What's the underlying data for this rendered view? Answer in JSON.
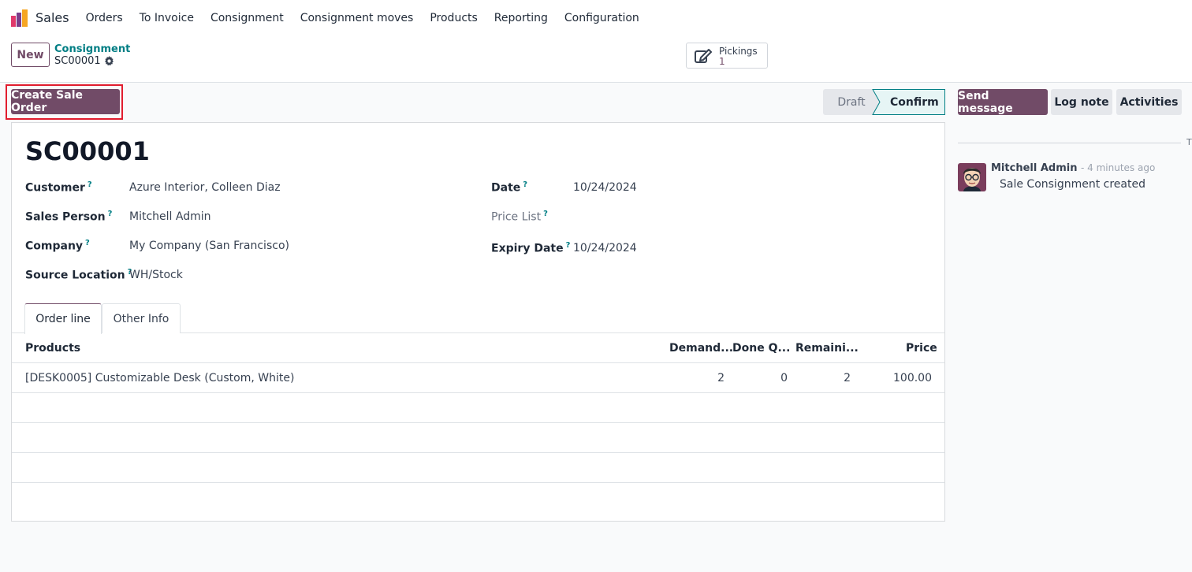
{
  "navbar": {
    "app_name": "Sales",
    "items": [
      "Orders",
      "To Invoice",
      "Consignment",
      "Consignment moves",
      "Products",
      "Reporting",
      "Configuration"
    ]
  },
  "control": {
    "new_label": "New",
    "breadcrumb_parent": "Consignment",
    "breadcrumb_current": "SC00001",
    "smart_button": {
      "label": "Pickings",
      "value": "1"
    }
  },
  "actions": {
    "create_sale_order": "Create Sale Order",
    "status": {
      "draft": "Draft",
      "confirm": "Confirm"
    },
    "send_message": "Send message",
    "log_note": "Log note",
    "activities": "Activities"
  },
  "form": {
    "title": "SC00001",
    "help_mark": "?",
    "left_fields": [
      {
        "label": "Customer",
        "value": "Azure Interior, Colleen Diaz"
      },
      {
        "label": "Sales Person",
        "value": "Mitchell Admin"
      },
      {
        "label": "Company",
        "value": "My Company (San Francisco)"
      },
      {
        "label": "Source Location",
        "value": "WH/Stock"
      }
    ],
    "right_fields": [
      {
        "label": "Date",
        "value": "10/24/2024"
      },
      {
        "label": "Price List",
        "value": ""
      },
      {
        "label": "Expiry Date",
        "value": "10/24/2024"
      }
    ],
    "tabs": [
      "Order line",
      "Other Info"
    ],
    "table": {
      "headers": [
        "Products",
        "Demand...",
        "Done Q...",
        "Remaini...",
        "Price"
      ],
      "rows": [
        [
          "[DESK0005] Customizable Desk (Custom, White)",
          "2",
          "0",
          "2",
          "100.00"
        ]
      ]
    }
  },
  "chatter": {
    "edge_text": "T",
    "author": "Mitchell Admin",
    "time": "- 4 minutes ago",
    "body": "Sale Consignment created"
  },
  "colors": {
    "primary": "#714b67",
    "link": "#017e84",
    "highlight": "#e11d2e"
  }
}
